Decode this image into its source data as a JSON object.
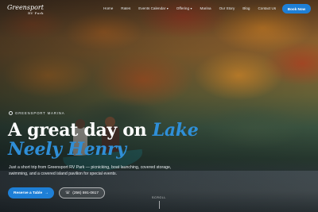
{
  "brand": {
    "name": "Greensport",
    "sub": "RV Park"
  },
  "nav": {
    "items": [
      {
        "label": "Home",
        "caret": false
      },
      {
        "label": "Rates",
        "caret": false
      },
      {
        "label": "Events Calendar",
        "caret": true
      },
      {
        "label": "Offering",
        "caret": true
      },
      {
        "label": "Marina",
        "caret": false
      },
      {
        "label": "Our Story",
        "caret": false
      },
      {
        "label": "Blog",
        "caret": false
      },
      {
        "label": "Contact Us",
        "caret": false
      }
    ],
    "book_label": "Book Now"
  },
  "hero": {
    "eyebrow": "Greensport Marina",
    "headline_plain": "A great day on ",
    "headline_accent": "Lake Neely Henry",
    "description": "Just a short trip from Greensport RV Park — picnicking, boat launching, covered storage, swimming, and a covered island pavilion for special events.",
    "reserve_label": "Reserve a Table",
    "reserve_arrow": "→",
    "phone_label": "(256) 591-0617",
    "phone_icon": "☏",
    "scroll_label": "SCROLL"
  },
  "colors": {
    "accent": "#1e7fd6",
    "headline_accent": "#2f8fd8"
  }
}
